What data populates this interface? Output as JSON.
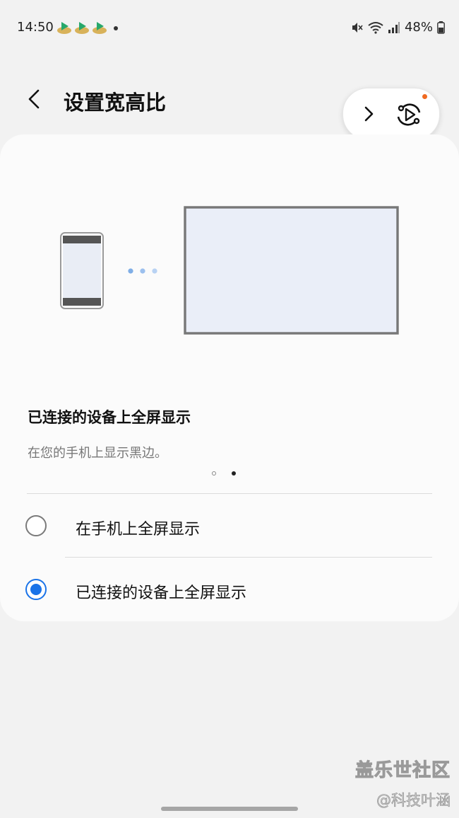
{
  "status_bar": {
    "time": "14:50",
    "notification_icons": [
      "app-icon",
      "app-icon",
      "app-icon"
    ],
    "battery": "48%",
    "icons": [
      "mute-icon",
      "wifi-icon",
      "signal-icon",
      "battery-icon"
    ]
  },
  "header": {
    "title": "设置宽高比",
    "back_icon": "chevron-left-icon"
  },
  "floating_pill": {
    "icons": [
      "chevron-right-icon",
      "smart-view-icon"
    ],
    "badge_color": "#f06a21"
  },
  "card": {
    "illustration": {
      "icons": [
        "phone-icon",
        "connection-dots-icon",
        "monitor-icon"
      ]
    },
    "option_title": "已连接的设备上全屏显示",
    "option_description": "在您的手机上显示黑边。",
    "pager": {
      "count": 2,
      "active_index": 1
    },
    "options": [
      {
        "label": "在手机上全屏显示",
        "selected": false
      },
      {
        "label": "已连接的设备上全屏显示",
        "selected": true
      }
    ]
  },
  "watermark": {
    "line1": "盖乐世社区",
    "line2": "@科技叶涵"
  },
  "colors": {
    "accent": "#1a73e8",
    "background": "#f2f2f2",
    "card": "#fbfbfb"
  }
}
